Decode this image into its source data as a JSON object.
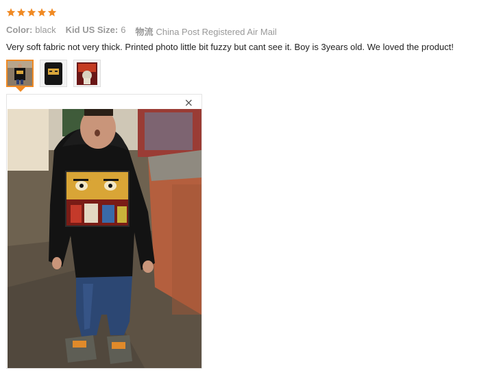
{
  "review": {
    "rating": 5,
    "attributes": [
      {
        "label": "Color:",
        "value": "black"
      },
      {
        "label": "Kid US Size:",
        "value": "6"
      },
      {
        "label": "物流",
        "value": "China Post Registered Air Mail"
      }
    ],
    "comment": "Very soft fabric not very thick. Printed photo little bit fuzzy but cant see it. Boy is 3years old. We loved the product!",
    "thumbnails": [
      {
        "name": "photo-thumbnail-1",
        "active": true
      },
      {
        "name": "photo-thumbnail-2",
        "active": false
      },
      {
        "name": "photo-thumbnail-3",
        "active": false
      }
    ],
    "viewer": {
      "close_icon": "close-icon",
      "close_glyph": "×"
    }
  },
  "colors": {
    "star": "#f08a24",
    "accent": "#f08a24",
    "muted_text": "#999999",
    "text": "#222222"
  }
}
